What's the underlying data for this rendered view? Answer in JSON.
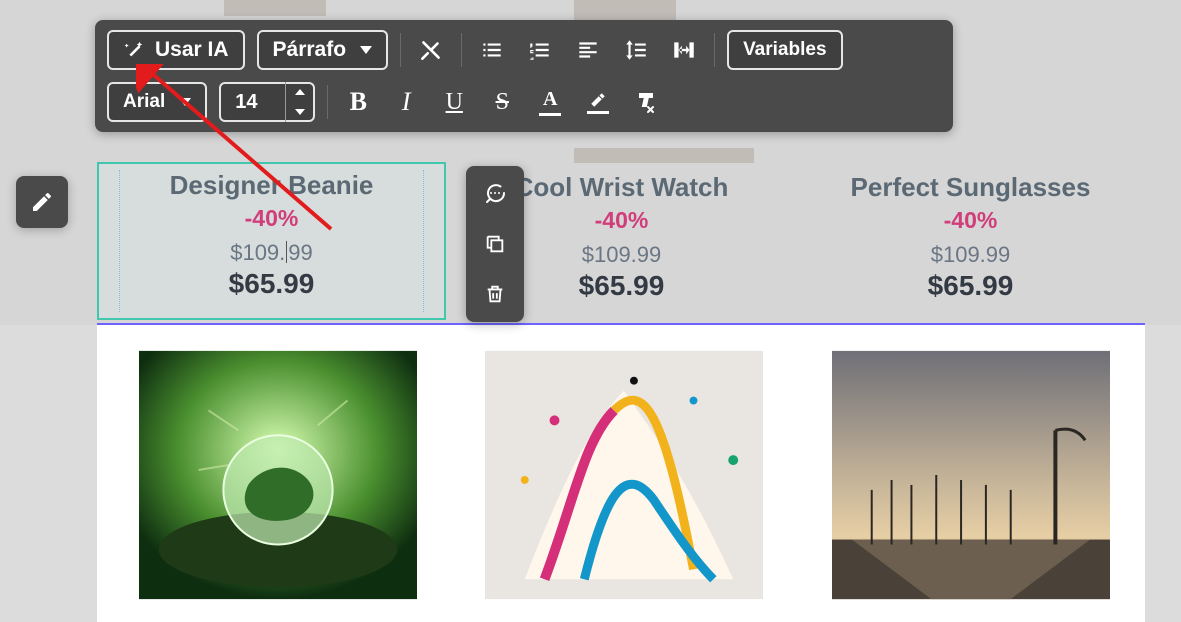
{
  "toolbar": {
    "use_ai_label": "Usar IA",
    "paragraph_label": "Párrafo",
    "variables_label": "Variables",
    "font_family": "Arial",
    "font_size": "14"
  },
  "products": [
    {
      "title": "Designer Beanie",
      "discount": "-40%",
      "old_price": "$109.99",
      "price": "$65.99"
    },
    {
      "title": "Cool Wrist Watch",
      "discount": "-40%",
      "old_price": "$109.99",
      "price": "$65.99"
    },
    {
      "title": "Perfect Sunglasses",
      "discount": "-40%",
      "old_price": "$109.99",
      "price": "$65.99"
    }
  ],
  "selected_product_old_price_parts": {
    "left": "$109.",
    "right": "99"
  },
  "icons": {
    "wand": "wand-icon",
    "clear_fmt": "clear-format-icon",
    "list_ul": "list-ul-icon",
    "list_ol": "list-ol-icon",
    "align": "align-icon",
    "line_height": "line-height-icon",
    "column_width": "column-width-icon",
    "bold": "B",
    "italic": "I",
    "underline": "U",
    "strike": "S",
    "text_color": "A",
    "highlight": "highlight-icon",
    "remove_style": "remove-style-icon",
    "comment": "comment-icon",
    "copy": "copy-icon",
    "trash": "trash-icon",
    "pencil": "pencil-icon"
  },
  "colors": {
    "toolbar_bg": "#4a4a4a",
    "selection_border": "#41c7ad",
    "discount_color": "#d13d7a",
    "page_sel": "#6e63ff"
  }
}
